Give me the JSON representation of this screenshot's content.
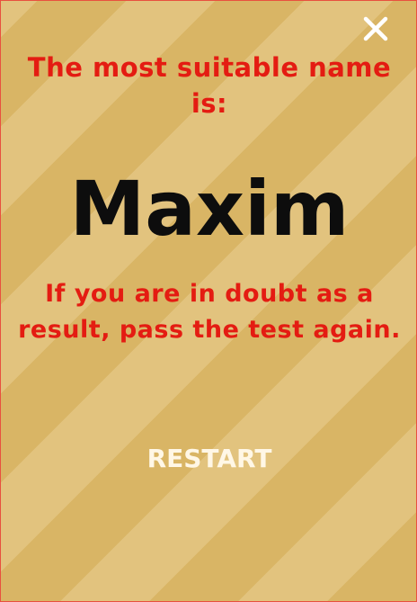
{
  "heading": "The most suitable name is:",
  "result_name": "Maxim",
  "advice": "If you are in doubt as a result, pass the test again.",
  "restart_label": "RESTART",
  "close_icon": "close-icon",
  "colors": {
    "accent_text": "#e41c12",
    "name_text": "#0d0d0d",
    "button_text": "#fff7e6",
    "stripe_dark": "#d9b565",
    "stripe_light": "#e2c37e",
    "border": "#e8503f"
  }
}
